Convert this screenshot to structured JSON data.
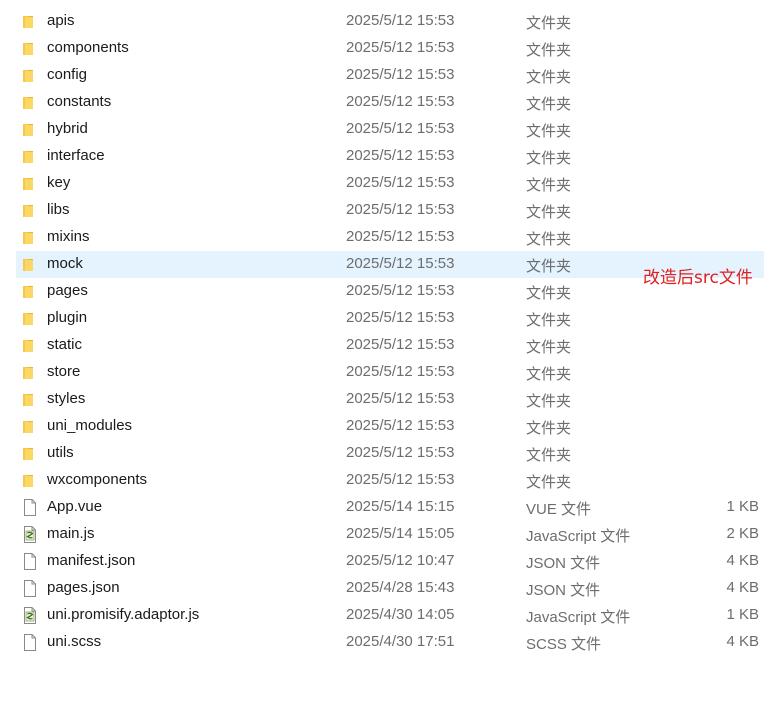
{
  "items": [
    {
      "name": "apis",
      "date": "2025/5/12 15:53",
      "type": "文件夹",
      "size": "",
      "icon": "folder-icon"
    },
    {
      "name": "components",
      "date": "2025/5/12 15:53",
      "type": "文件夹",
      "size": "",
      "icon": "folder-icon"
    },
    {
      "name": "config",
      "date": "2025/5/12 15:53",
      "type": "文件夹",
      "size": "",
      "icon": "folder-icon"
    },
    {
      "name": "constants",
      "date": "2025/5/12 15:53",
      "type": "文件夹",
      "size": "",
      "icon": "folder-icon"
    },
    {
      "name": "hybrid",
      "date": "2025/5/12 15:53",
      "type": "文件夹",
      "size": "",
      "icon": "folder-icon"
    },
    {
      "name": "interface",
      "date": "2025/5/12 15:53",
      "type": "文件夹",
      "size": "",
      "icon": "folder-icon"
    },
    {
      "name": "key",
      "date": "2025/5/12 15:53",
      "type": "文件夹",
      "size": "",
      "icon": "folder-icon"
    },
    {
      "name": "libs",
      "date": "2025/5/12 15:53",
      "type": "文件夹",
      "size": "",
      "icon": "folder-icon"
    },
    {
      "name": "mixins",
      "date": "2025/5/12 15:53",
      "type": "文件夹",
      "size": "",
      "icon": "folder-icon"
    },
    {
      "name": "mock",
      "date": "2025/5/12 15:53",
      "type": "文件夹",
      "size": "",
      "icon": "folder-icon",
      "selected": true
    },
    {
      "name": "pages",
      "date": "2025/5/12 15:53",
      "type": "文件夹",
      "size": "",
      "icon": "folder-icon"
    },
    {
      "name": "plugin",
      "date": "2025/5/12 15:53",
      "type": "文件夹",
      "size": "",
      "icon": "folder-icon"
    },
    {
      "name": "static",
      "date": "2025/5/12 15:53",
      "type": "文件夹",
      "size": "",
      "icon": "folder-icon"
    },
    {
      "name": "store",
      "date": "2025/5/12 15:53",
      "type": "文件夹",
      "size": "",
      "icon": "folder-icon"
    },
    {
      "name": "styles",
      "date": "2025/5/12 15:53",
      "type": "文件夹",
      "size": "",
      "icon": "folder-icon"
    },
    {
      "name": "uni_modules",
      "date": "2025/5/12 15:53",
      "type": "文件夹",
      "size": "",
      "icon": "folder-icon"
    },
    {
      "name": "utils",
      "date": "2025/5/12 15:53",
      "type": "文件夹",
      "size": "",
      "icon": "folder-icon"
    },
    {
      "name": "wxcomponents",
      "date": "2025/5/12 15:53",
      "type": "文件夹",
      "size": "",
      "icon": "folder-icon"
    },
    {
      "name": "App.vue",
      "date": "2025/5/14 15:15",
      "type": "VUE 文件",
      "size": "1 KB",
      "icon": "file-icon"
    },
    {
      "name": "main.js",
      "date": "2025/5/14 15:05",
      "type": "JavaScript 文件",
      "size": "2 KB",
      "icon": "script-file-icon"
    },
    {
      "name": "manifest.json",
      "date": "2025/5/12 10:47",
      "type": "JSON 文件",
      "size": "4 KB",
      "icon": "file-icon"
    },
    {
      "name": "pages.json",
      "date": "2025/4/28 15:43",
      "type": "JSON 文件",
      "size": "4 KB",
      "icon": "file-icon"
    },
    {
      "name": "uni.promisify.adaptor.js",
      "date": "2025/4/30 14:05",
      "type": "JavaScript 文件",
      "size": "1 KB",
      "icon": "script-file-icon"
    },
    {
      "name": "uni.scss",
      "date": "2025/4/30 17:51",
      "type": "SCSS 文件",
      "size": "4 KB",
      "icon": "file-icon"
    }
  ],
  "annotation": "改造后src文件",
  "colors": {
    "selection": "#e5f3ff",
    "annotation": "#e02020",
    "folder": "#f3c444",
    "secondary_text": "#6d6d6d"
  }
}
